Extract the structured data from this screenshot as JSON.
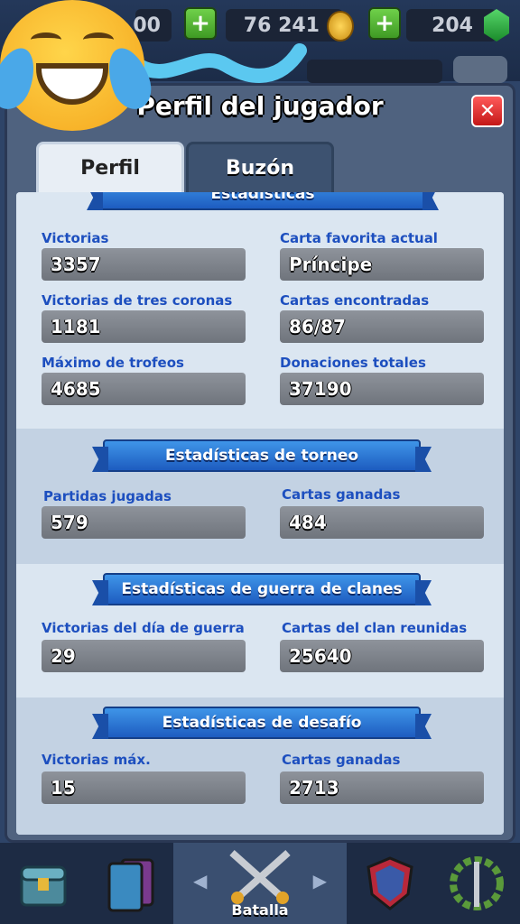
{
  "topbar": {
    "pill1_value": "00",
    "gold_value": "76 241",
    "gems_value": "204",
    "plus_label": "+"
  },
  "modal": {
    "title": "Perfil del jugador",
    "close_label": "✕",
    "tabs": [
      {
        "label": "Perfil",
        "active": true
      },
      {
        "label": "Buzón",
        "active": false
      }
    ]
  },
  "stats": {
    "ribbon_title": "Estadísticas",
    "items": [
      {
        "label": "Victorias",
        "value": "3357"
      },
      {
        "label": "Carta favorita actual",
        "value": "Príncipe"
      },
      {
        "label": "Victorias de tres coronas",
        "value": "1181"
      },
      {
        "label": "Cartas encontradas",
        "value": "86/87"
      },
      {
        "label": "Máximo de trofeos",
        "value": "4685"
      },
      {
        "label": "Donaciones totales",
        "value": "37190"
      }
    ]
  },
  "tournament": {
    "ribbon_title": "Estadísticas de torneo",
    "items": [
      {
        "label": "Partidas jugadas",
        "value": "579"
      },
      {
        "label": "Cartas ganadas",
        "value": "484"
      }
    ]
  },
  "clanwar": {
    "ribbon_title": "Estadísticas de guerra de clanes",
    "items": [
      {
        "label": "Victorias del día de guerra",
        "value": "29"
      },
      {
        "label": "Cartas del clan reunidas",
        "value": "25640"
      }
    ]
  },
  "challenge": {
    "ribbon_title": "Estadísticas de desafío",
    "items": [
      {
        "label": "Victorias máx.",
        "value": "15"
      },
      {
        "label": "Cartas ganadas",
        "value": "2713"
      }
    ]
  },
  "bottomnav": {
    "battle_label": "Batalla",
    "arrow_left": "◀",
    "arrow_right": "▶"
  },
  "colors": {
    "label_blue": "#1d4fbf",
    "ribbon_blue": "#2a7ad8",
    "close_red": "#d92020"
  }
}
